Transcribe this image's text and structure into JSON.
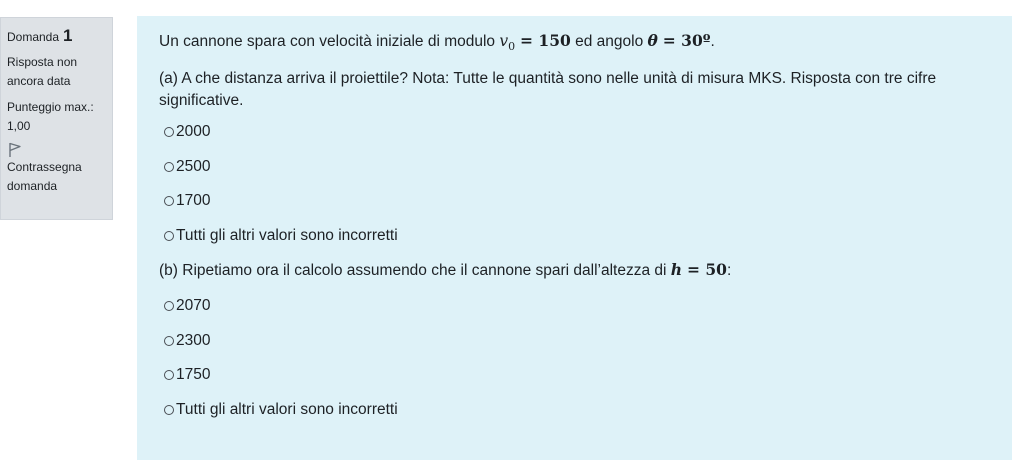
{
  "info": {
    "question_label": "Domanda",
    "question_number": "1",
    "state": "Risposta non ancora data",
    "grade": "Punteggio max.: 1,00",
    "flag_label": "Contrassegna domanda",
    "flag_icon": "flag-icon"
  },
  "question": {
    "intro_before_v": "Un cannone spara con velocità iniziale di modulo ",
    "v_symbol": "v",
    "v_subscript": "0",
    "v_value": "= 150",
    "intro_middle": " ed angolo ",
    "theta_symbol": "θ",
    "theta_value": "= 30º",
    "intro_end": ".",
    "part_a": "(a) A che distanza arriva il proiettile? Nota: Tutte le quantità  sono nelle unità  di misura MKS. Risposta con tre cifre significative.",
    "options_a": [
      "2000",
      "2500",
      "1700",
      "Tutti gli altri valori sono incorretti"
    ],
    "part_b_before": "(b) Ripetiamo ora il calcolo assumendo che il cannone spari dall’altezza di ",
    "h_symbol": "h",
    "h_value": "= 50",
    "part_b_end": ":",
    "options_b": [
      "2070",
      "2300",
      "1750",
      "Tutti gli altri valori sono incorretti"
    ]
  }
}
